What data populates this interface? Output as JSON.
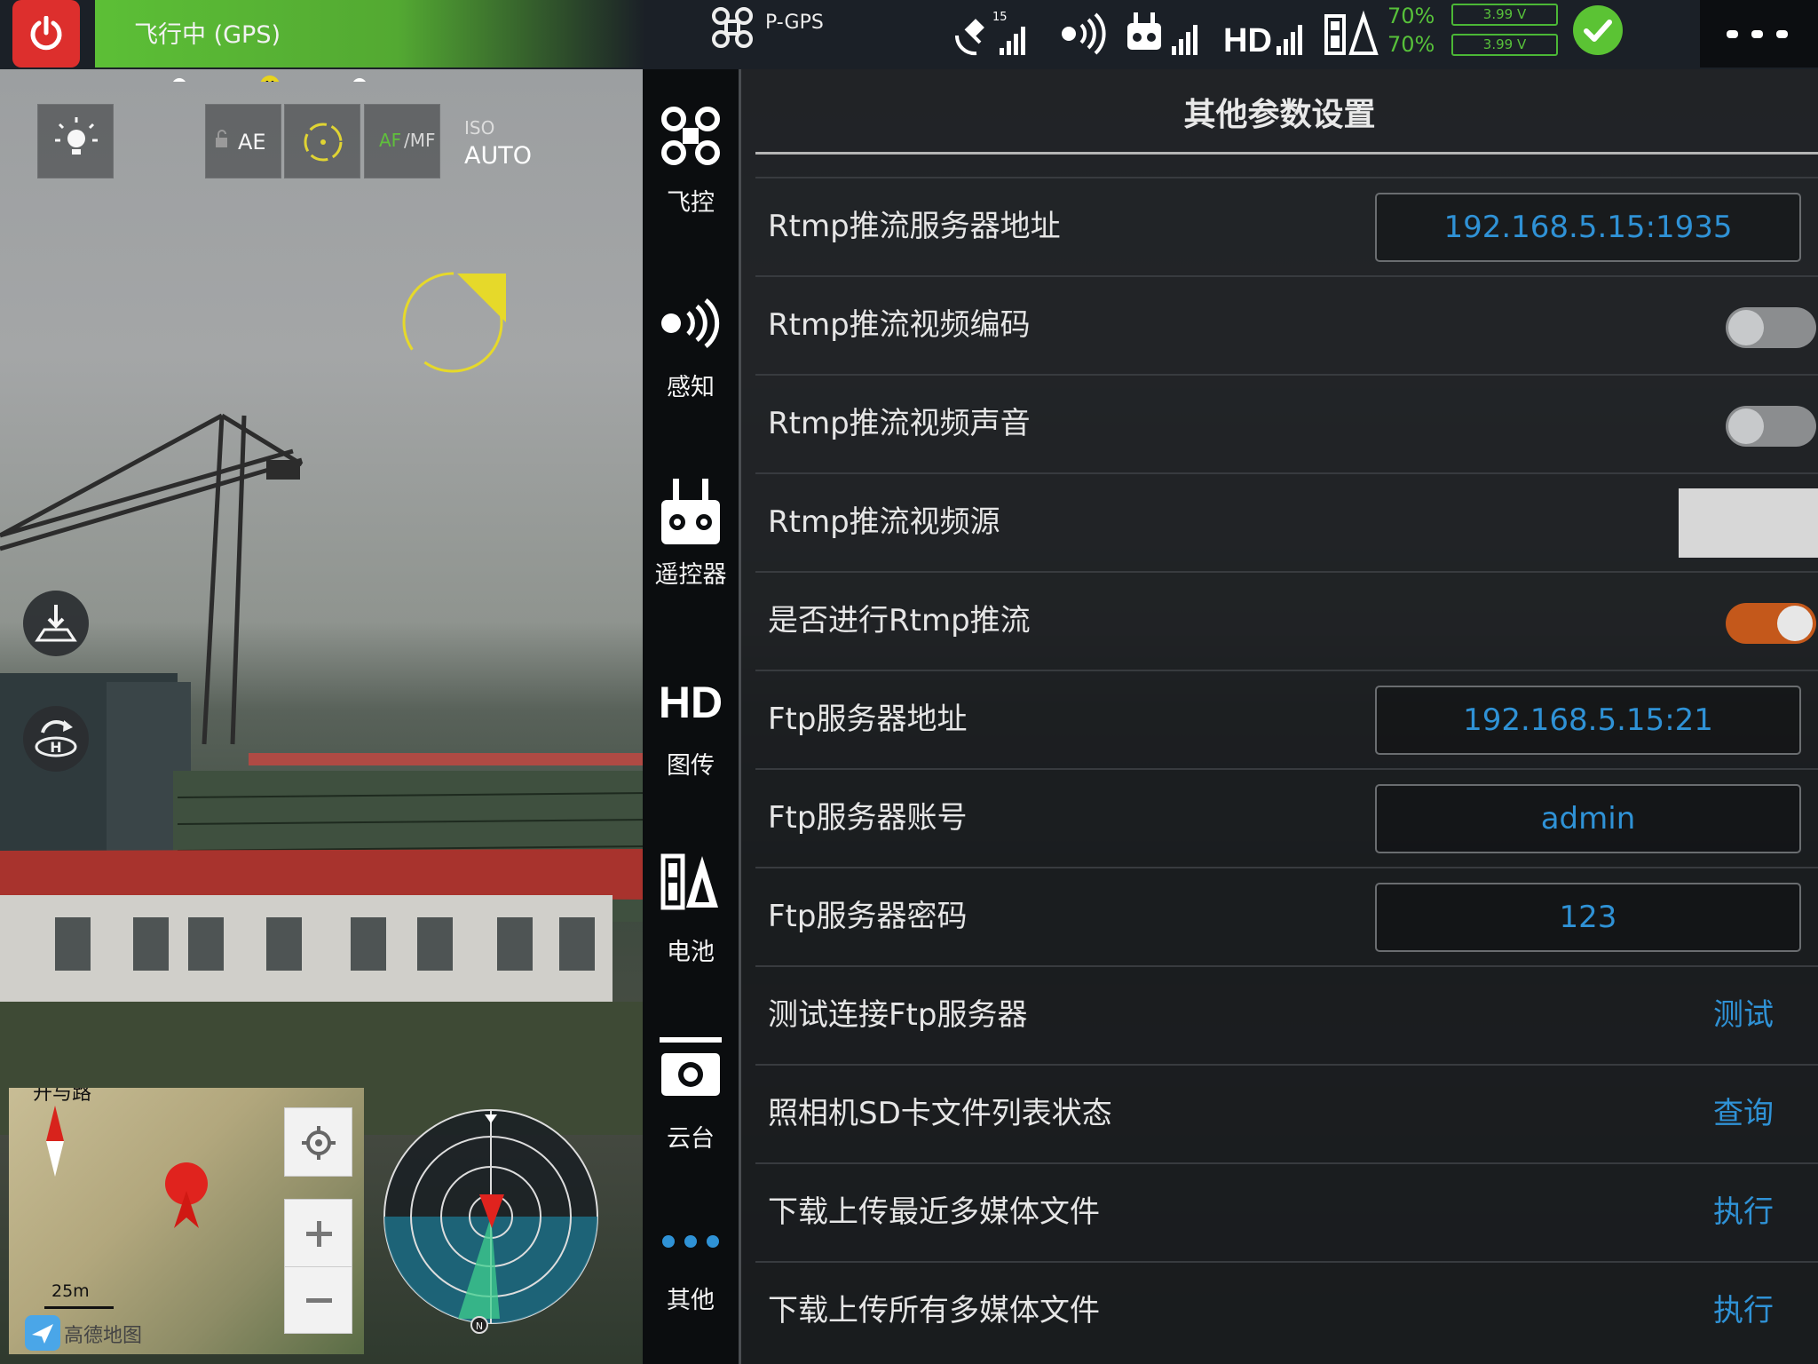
{
  "topbar": {
    "flight_status": "飞行中 (GPS)",
    "flight_mode": "P-GPS",
    "satellite_count": "15",
    "battery_pct_1": "70%",
    "battery_pct_2": "70%",
    "cell_voltage_1": "3.99 V",
    "cell_voltage_2": "3.99 V",
    "status_color": "#5bc334",
    "alert_color": "#dd2f2d"
  },
  "progress": {
    "home_marker": "H"
  },
  "camera_toolbar": {
    "ae_label": "AE",
    "af_label": "AF",
    "mf_label": "/MF",
    "iso_label": "ISO",
    "iso_value": "AUTO"
  },
  "map": {
    "road_label": "开与路",
    "scale": "25m",
    "brand": "高德地图"
  },
  "sidebar": {
    "items": [
      {
        "label": "飞控",
        "icon": "drone-icon"
      },
      {
        "label": "感知",
        "icon": "sensor-icon"
      },
      {
        "label": "遥控器",
        "icon": "remote-controller-icon"
      },
      {
        "label": "图传",
        "icon": "hd-icon"
      },
      {
        "label": "电池",
        "icon": "battery-icon"
      },
      {
        "label": "云台",
        "icon": "camera-icon"
      },
      {
        "label": "其他",
        "icon": "more-dots-icon"
      }
    ],
    "active_color": "#2f92d6"
  },
  "panel": {
    "title": "其他参数设置",
    "rows": [
      {
        "label": "Rtmp推流服务器地址",
        "value": "192.168.5.15:1935"
      },
      {
        "label": "Rtmp推流视频编码",
        "toggle": "off"
      },
      {
        "label": "Rtmp推流视频声音",
        "toggle": "off"
      },
      {
        "label": "Rtmp推流视频源"
      },
      {
        "label": "是否进行Rtmp推流",
        "toggle": "on"
      },
      {
        "label": "Ftp服务器地址",
        "value": "192.168.5.15:21"
      },
      {
        "label": "Ftp服务器账号",
        "value": "admin"
      },
      {
        "label": "Ftp服务器密码",
        "value": "123"
      },
      {
        "label": "测试连接Ftp服务器",
        "action": "测试"
      },
      {
        "label": "照相机SD卡文件列表状态",
        "action": "查询"
      },
      {
        "label": "下载上传最近多媒体文件",
        "action": "执行"
      },
      {
        "label": "下载上传所有多媒体文件",
        "action": "执行"
      }
    ],
    "toggle_on_color": "#c4581b",
    "value_color": "#2f92d6"
  }
}
